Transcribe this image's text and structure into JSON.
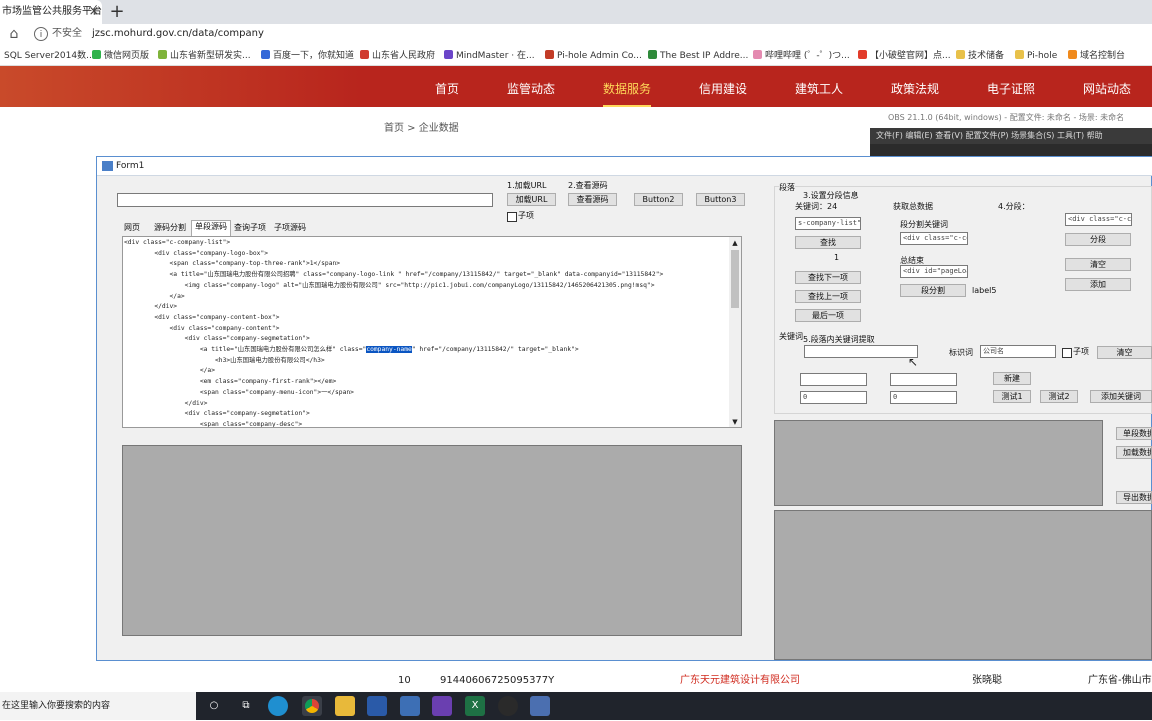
{
  "browser": {
    "tab_title": "市场监管公共服务平台",
    "tab_close": "×",
    "new_tab": "+",
    "not_secure": "不安全",
    "url": "jzsc.mohurd.gov.cn/data/company",
    "bookmarks": [
      "SQL Server2014数...",
      "微信网页版",
      "山东省新型研发实...",
      "百度一下，你就知道",
      "山东省人民政府",
      "MindMaster · 在...",
      "Pi-hole Admin Co...",
      "The Best IP Addre...",
      "哔哩哔哩 (゜-゜)つ...",
      "【小破壁官网】点...",
      "技术储备",
      "Pi-hole",
      "域名控制台"
    ]
  },
  "site": {
    "nav": [
      "首页",
      "监管动态",
      "数据服务",
      "信用建设",
      "建筑工人",
      "政策法规",
      "电子证照",
      "网站动态"
    ],
    "active_nav": "数据服务",
    "breadcrumb": "首页  >  企业数据",
    "row": {
      "index": "10",
      "code": "91440606725095377Y",
      "company": "广东天元建筑设计有限公司",
      "person": "张晓聪",
      "region": "广东省-佛山市"
    }
  },
  "obs": {
    "title": "OBS 21.1.0 (64bit, windows) - 配置文件: 未命名 - 场景: 未命名",
    "menu": "文件(F)   编辑(E)   查看(V)   配置文件(P)   场景集合(S)   工具(T)   帮助"
  },
  "form": {
    "title": "Form1",
    "url_input": "",
    "load_label": "1.加载URL",
    "load_button": "加载URL",
    "view_label": "2.查看源码",
    "view_button": "查看源码",
    "button2": "Button2",
    "button3": "Button3",
    "subitem_checkbox": "子项",
    "tabs": [
      "网页",
      "源码分割",
      "单段源码",
      "查询子项",
      "子项源码"
    ],
    "selected_tab": "单段源码",
    "code_lines": [
      "<div class=\"c-company-list\">",
      "        <div class=\"company-logo-box\">",
      "            <span class=\"company-top-three-rank\">1</span>",
      "            <a title=\"山东国瑞电力股份有限公司招聘\" class=\"company-logo-link \" href=\"/company/13115842/\" target=\"_blank\" data-companyid=\"13115842\">",
      "                <img class=\"company-logo\" alt=\"山东国瑞电力股份有限公司\" src=\"http://pic1.jobui.com/companyLogo/13115842/1465206421305.png!msq\">",
      "            </a>",
      "        </div>",
      "        <div class=\"company-content-box\">",
      "            <div class=\"company-content\">",
      "                <div class=\"company-segmetation\">"
    ],
    "code_line_a_pre": "                    <a title=\"山东国瑞电力股份有限公司怎么样\" class=\"",
    "code_line_a_hl": "company-name",
    "code_line_a_post": "\" href=\"/company/13115842/\" target=\"_blank\">",
    "code_lines_after": [
      "                        <h3>山东国瑞电力股份有限公司</h3>",
      "                    </a>",
      "                    <em class=\"company-first-rank\"></em>",
      "                    <span class=\"company-menu-icon\">一</span>",
      "                </div>",
      "                <div class=\"company-segmetation\">",
      "                    <span class=\"company-desc\">"
    ],
    "right": {
      "group_title": "段落",
      "step3": "3.设置分段信息",
      "keyword_label": "关键词：24",
      "keyword_value": "s-company-list\">",
      "find_button": "查找",
      "count": "1",
      "find_next": "查找下一项",
      "find_prev": "查找上一项",
      "last_item": "最后一项",
      "total_label": "获取总数据",
      "seg_keyword_label": "段分割关键词",
      "seg_keyword_value": "<div class=\"c-co",
      "total_set_label": "总结束",
      "total_set_value": "<div id=\"pageLoa",
      "seg_split_button": "段分割",
      "label5": "label5",
      "step4": "4.分段：",
      "step4_value": "<div class=\"c-co",
      "split_button": "分段",
      "clear_button": "清空",
      "add_button": "添加",
      "kw_group_title": "关键词",
      "step5": "5.段落内关键词提取",
      "kw_input": "",
      "id_label": "标识词",
      "id_value": "公司名",
      "kw_subitem": "子项",
      "kw_clear": "清空",
      "in1": "",
      "in2": "",
      "in3": "0",
      "in4": "0",
      "new_button": "新建",
      "test1": "测试1",
      "test2": "测试2",
      "add_kw_button": "添加关键词",
      "single_seg_button": "单段数据",
      "load_data_button": "加载数据",
      "export_button": "导出数据"
    }
  },
  "taskbar": {
    "search_placeholder": "在这里输入你要搜索的内容"
  }
}
